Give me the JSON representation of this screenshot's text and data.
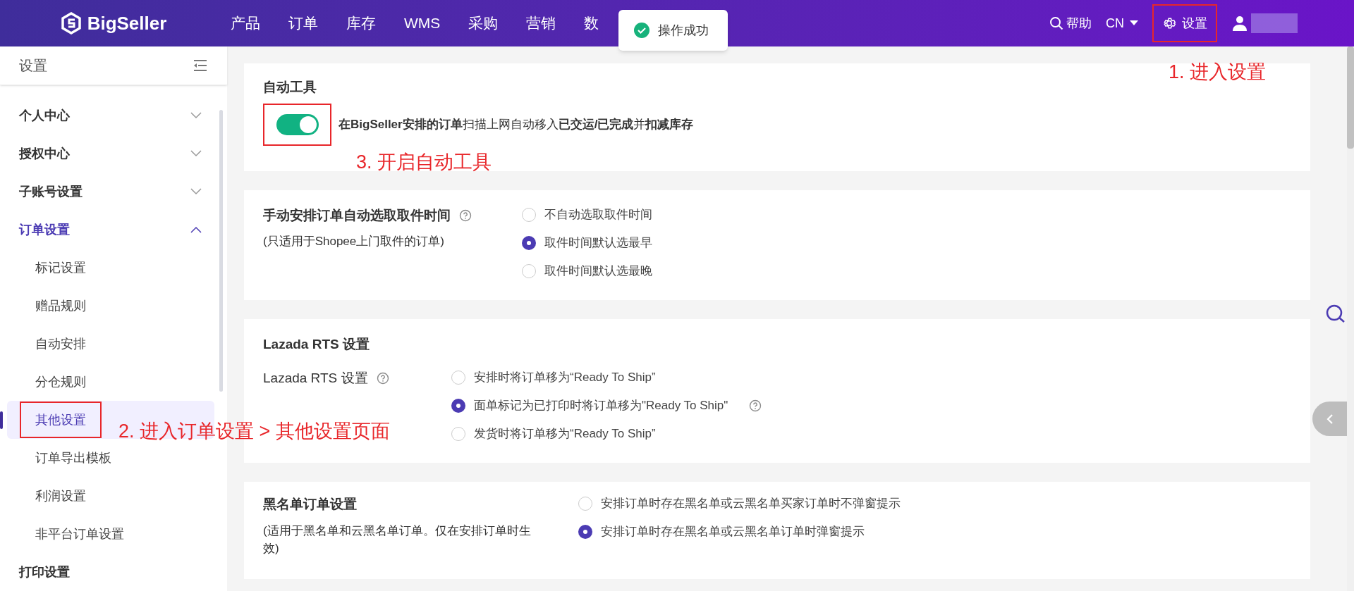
{
  "header": {
    "logo": "BigSeller",
    "nav": [
      "产品",
      "订单",
      "库存",
      "WMS",
      "采购",
      "营销",
      "数"
    ],
    "help": "帮助",
    "lang": "CN",
    "settings": {
      "label": "设置",
      "highlighted": true
    }
  },
  "toast": {
    "message": "操作成功"
  },
  "sidebar": {
    "title": "设置",
    "groups": [
      {
        "label": "个人中心",
        "expanded": false
      },
      {
        "label": "授权中心",
        "expanded": false
      },
      {
        "label": "子账号设置",
        "expanded": false
      },
      {
        "label": "订单设置",
        "expanded": true,
        "children": [
          {
            "label": "标记设置",
            "selected": false,
            "highlighted": false
          },
          {
            "label": "赠品规则",
            "selected": false,
            "highlighted": false
          },
          {
            "label": "自动安排",
            "selected": false,
            "highlighted": false
          },
          {
            "label": "分仓规则",
            "selected": false,
            "highlighted": false
          },
          {
            "label": "其他设置",
            "selected": true,
            "highlighted": true
          },
          {
            "label": "订单导出模板",
            "selected": false,
            "highlighted": false
          },
          {
            "label": "利润设置",
            "selected": false,
            "highlighted": false
          },
          {
            "label": "非平台订单设置",
            "selected": false,
            "highlighted": false
          }
        ]
      },
      {
        "label": "打印设置",
        "expanded": false
      }
    ]
  },
  "sections": [
    {
      "kind": "toggle",
      "title": "自动工具",
      "toggle": {
        "on": true,
        "highlighted": true
      },
      "description": "**在BigSeller安排的订单**扫描上网自动移入**已交运/已完成**并**扣减库存**"
    },
    {
      "kind": "radio",
      "label": "手动安排订单自动选取取件时间",
      "help": true,
      "note": "(只适用于Shopee上门取件的订单)",
      "options": [
        {
          "label": "不自动选取取件时间",
          "selected": false,
          "help": false
        },
        {
          "label": "取件时间默认选最早",
          "selected": true,
          "help": false
        },
        {
          "label": "取件时间默认选最晚",
          "selected": false,
          "help": false
        }
      ]
    },
    {
      "kind": "radio",
      "heading": "Lazada RTS 设置",
      "label": "Lazada RTS 设置",
      "help": true,
      "options": [
        {
          "label": "安排时将订单移为“Ready To Ship”",
          "selected": false,
          "help": false
        },
        {
          "label": "面单标记为已打印时将订单移为\"Ready To Ship\"",
          "selected": true,
          "help": true
        },
        {
          "label": "发货时将订单移为“Ready To Ship”",
          "selected": false,
          "help": false
        }
      ]
    },
    {
      "kind": "radio",
      "label": "黑名单订单设置",
      "help": false,
      "note": "(适用于黑名单和云黑名单订单。仅在安排订单时生效)",
      "options": [
        {
          "label": "安排订单时存在黑名单或云黑名单买家订单时不弹窗提示",
          "selected": false,
          "help": false
        },
        {
          "label": "安排订单时存在黑名单或云黑名单订单时弹窗提示",
          "selected": true,
          "help": false
        }
      ]
    }
  ],
  "annotations": [
    {
      "text": "1. 进入设置"
    },
    {
      "text": "2. 进入订单设置 > 其他设置页面"
    },
    {
      "text": "3. 开启自动工具"
    }
  ]
}
